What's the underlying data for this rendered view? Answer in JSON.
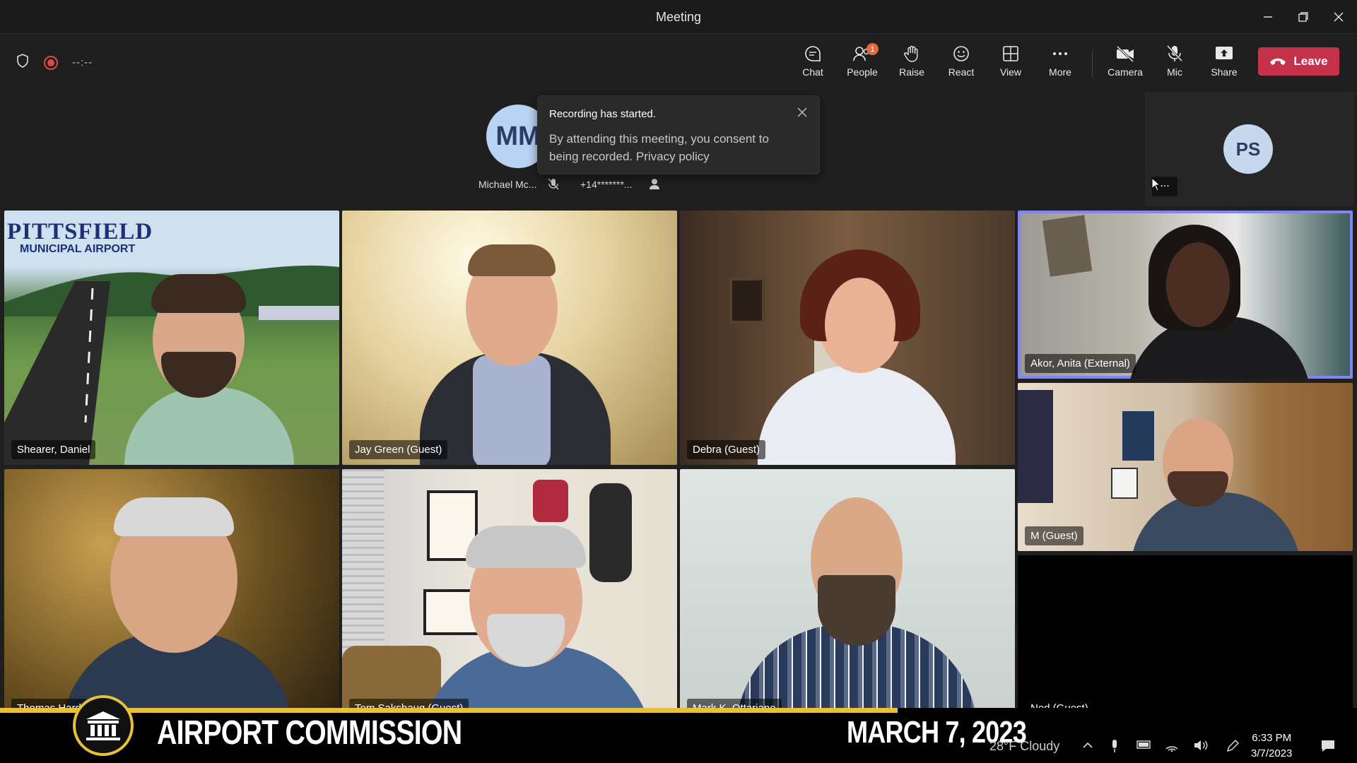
{
  "window": {
    "title": "Meeting"
  },
  "toolbar": {
    "timer": "--:--",
    "buttons": {
      "chat": "Chat",
      "people": "People",
      "people_badge": "1",
      "raise": "Raise",
      "react": "React",
      "view": "View",
      "more": "More",
      "camera": "Camera",
      "mic": "Mic",
      "share": "Share"
    },
    "leave": "Leave"
  },
  "strip": {
    "michael_initials": "MM",
    "michael_label": "Michael Mc...",
    "phone_label": "+14*******...",
    "ps_initials": "PS",
    "overflow": "..."
  },
  "toast": {
    "title": "Recording has started.",
    "body": "By attending this meeting, you consent to being recorded. Privacy policy"
  },
  "participants": {
    "p1": "Shearer, Daniel",
    "p2": "Jay Green (Guest)",
    "p3": "Debra (Guest)",
    "p4": "Akor, Anita (External)",
    "p5": "M (Guest)",
    "p6": "Thomas Hard",
    "p7": "Tom Sakshaug (Guest)",
    "p8": "Mark K. Ottariano",
    "p9": "Ned (Guest)"
  },
  "airport_bg": {
    "line1": "PITTSFIELD",
    "line2": "MUNICIPAL AIRPORT"
  },
  "banner": {
    "title": "AIRPORT COMMISSION",
    "date": "MARCH 7, 2023"
  },
  "taskbar": {
    "weather": "28°F Cloudy",
    "time": "6:33 PM",
    "date": "3/7/2023"
  }
}
